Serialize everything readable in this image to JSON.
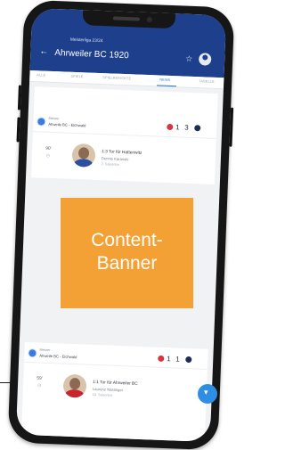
{
  "app": {
    "league": "Meisterliga 23/24",
    "title": "Ahrweiler BC 1920"
  },
  "tabs": [
    "ALLE",
    "SPIELE",
    "SPIELBERICHTE",
    "NEWS",
    "TABELLE"
  ],
  "active_tab": "NEWS",
  "feed": [
    {
      "competition": "Meister",
      "match": "Ahweile BC - Elchwald",
      "home_goals": "1",
      "away_goals": "3",
      "minute": "90'",
      "goal_text": "1:3 Tor für Hattenwitz",
      "player": "Dennis Karanski",
      "season_info": "2. Saisontor"
    },
    {
      "competition": "Meister",
      "match": "Ahweile BC - Elchwald",
      "home_goals": "1",
      "away_goals": "1",
      "minute": "59'",
      "goal_text": "1:1 Tor für Ahrweiler BC",
      "player": "Laurenz Nästinger",
      "season_info": "10. Saisontor"
    }
  ],
  "banner": {
    "line1": "Content-",
    "line2": "Banner"
  },
  "colors": {
    "appbar": "#1d3f8c",
    "accent": "#1e73d6",
    "banner": "#f3a034",
    "fab": "#2f8ee3"
  },
  "icons": [
    "back-arrow-icon",
    "star-icon",
    "user-avatar-icon",
    "competition-icon",
    "club-crest-icon",
    "ball-icon",
    "clock-icon",
    "chevron-down-icon"
  ]
}
